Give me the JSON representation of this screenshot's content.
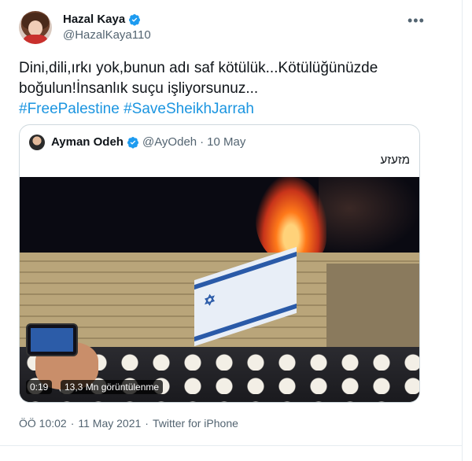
{
  "author": {
    "display_name": "Hazal Kaya",
    "handle": "@HazalKaya110",
    "verified_icon": "verified-badge-icon",
    "more_icon": "more-options-icon"
  },
  "tweet": {
    "line1": "Dini,dili,ırkı yok,bunun adı saf kötülük...Kötülüğünüzde",
    "line2": "boğulun!İnsanlık suçu işliyorsunuz...",
    "hashtags": [
      "#FreePalestine",
      "#SaveSheikhJarrah"
    ]
  },
  "quoted_tweet": {
    "display_name": "Ayman Odeh",
    "handle": "@AyOdeh",
    "separator": "·",
    "date": "10 May",
    "text": "מזעזע",
    "video": {
      "time": "0:19",
      "views": "13,3 Mn görüntülenme"
    }
  },
  "meta": {
    "time": "ÖÖ 10:02",
    "separator": "·",
    "date": "11 May 2021",
    "separator2": "·",
    "source": "Twitter for iPhone"
  },
  "colors": {
    "link": "#1b95e0",
    "verified": "#1d9bf0",
    "muted": "#536471"
  }
}
